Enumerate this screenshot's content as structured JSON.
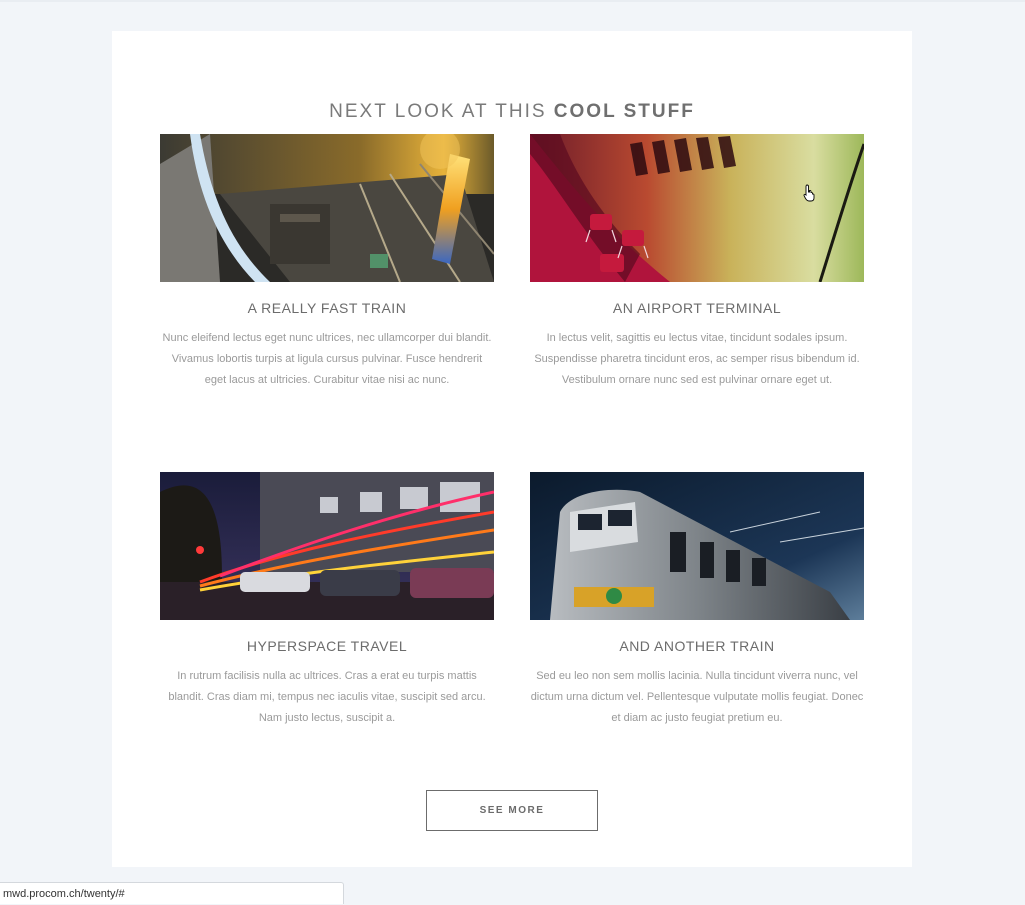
{
  "section": {
    "title_prefix": "NEXT LOOK AT THIS ",
    "title_emphasis": "COOL STUFF"
  },
  "items": [
    {
      "title": "A REALLY FAST TRAIN",
      "text": "Nunc eleifend lectus eget nunc ultrices, nec ullamcorper dui blandit. Vivamus lobortis turpis at ligula cursus pulvinar. Fusce hendrerit eget lacus at ultricies. Curabitur vitae nisi ac nunc."
    },
    {
      "title": "AN AIRPORT TERMINAL",
      "text": "In lectus velit, sagittis eu lectus vitae, tincidunt sodales ipsum. Suspendisse pharetra tincidunt eros, ac semper risus bibendum id. Vestibulum ornare nunc sed est pulvinar ornare eget ut."
    },
    {
      "title": "HYPERSPACE TRAVEL",
      "text": "In rutrum facilisis nulla ac ultrices. Cras a erat eu turpis mattis blandit. Cras diam mi, tempus nec iaculis vitae, suscipit sed arcu. Nam justo lectus, suscipit a."
    },
    {
      "title": "AND ANOTHER TRAIN",
      "text": "Sed eu leo non sem mollis lacinia. Nulla tincidunt viverra nunc, vel dictum urna dictum vel. Pellentesque vulputate mollis feugiat. Donec et diam ac justo feugiat pretium eu."
    }
  ],
  "buttons": {
    "see_more": "SEE MORE"
  },
  "status": {
    "url": "mwd.procom.ch/twenty/#"
  },
  "icons": {
    "cursor": "hand-pointer-icon"
  }
}
